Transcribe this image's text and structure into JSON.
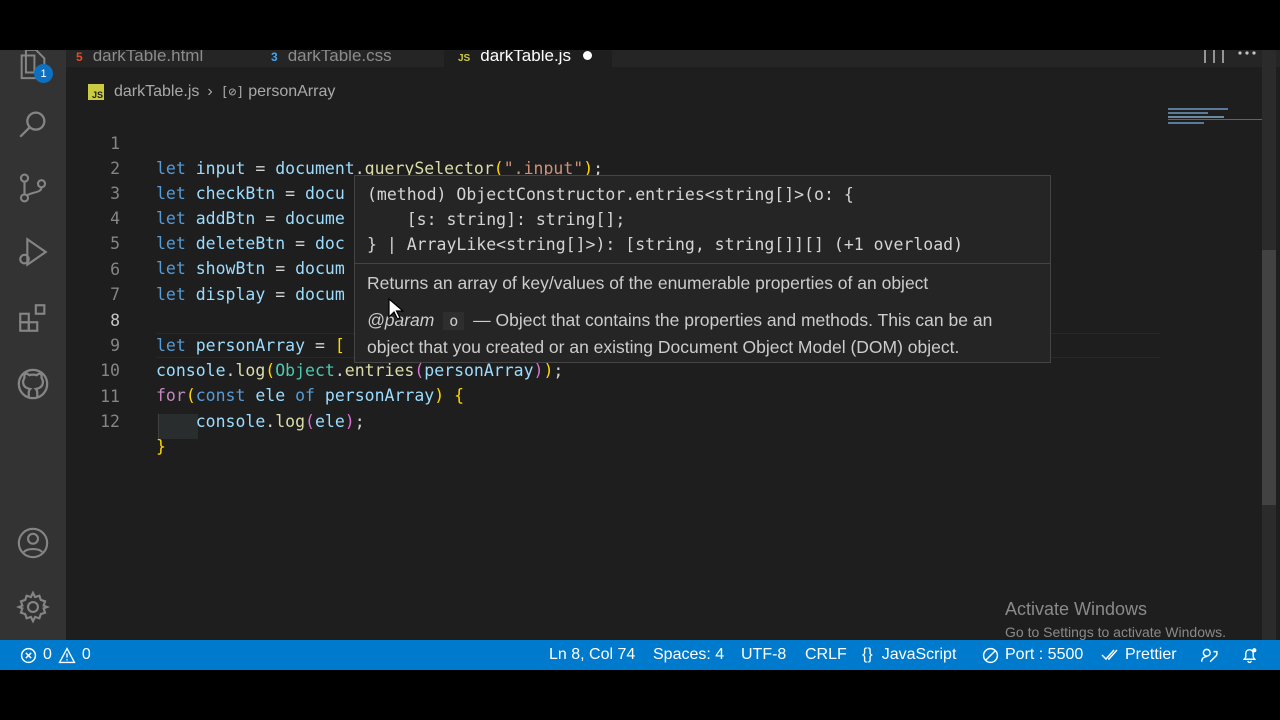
{
  "tabs": [
    {
      "icon": "html5-icon",
      "label": "darkTable.html",
      "active": false
    },
    {
      "icon": "css3-icon",
      "label": "darkTable.css",
      "active": false
    },
    {
      "icon": "js-file-icon",
      "label": "darkTable.js",
      "active": true,
      "modified": true
    }
  ],
  "activity_bar": {
    "explorer_badge": "1",
    "icons": [
      "files-icon",
      "search-icon",
      "source-control-icon",
      "run-debug-icon",
      "extensions-icon",
      "github-icon",
      "account-icon",
      "settings-gear-icon"
    ]
  },
  "breadcrumb": {
    "file_badge": "JS",
    "file": "darkTable.js",
    "symbol": "personArray"
  },
  "code_lines": [
    {
      "n": "1",
      "text": "let input = document.querySelector(\".input\");"
    },
    {
      "n": "2",
      "text": "let checkBtn = docu"
    },
    {
      "n": "3",
      "text": "let addBtn = docume"
    },
    {
      "n": "4",
      "text": "let deleteBtn = doc"
    },
    {
      "n": "5",
      "text": "let showBtn = docum"
    },
    {
      "n": "6",
      "text": "let display = docum"
    },
    {
      "n": "7",
      "text": ""
    },
    {
      "n": "8",
      "text": "let personArray = ["
    },
    {
      "n": "9",
      "text": "console.log(Object.entries(personArray));"
    },
    {
      "n": "10",
      "text": "for(const ele of personArray) {"
    },
    {
      "n": "11",
      "text": "    console.log(ele);"
    },
    {
      "n": "12",
      "text": "}"
    }
  ],
  "hover": {
    "sig_line1": "(method) ObjectConstructor.entries<string[]>(o: {",
    "sig_line2": "    [s: string]: string[];",
    "sig_line3": "} | ArrayLike<string[]>): [string, string[]][] (+1 overload)",
    "description": "Returns an array of key/values of the enumerable properties of an object",
    "param_tag": "@param",
    "param_name": "o",
    "param_desc_line1": "— Object that contains the properties and methods. This can be an",
    "param_desc_line2": "object that you created or an existing Document Object Model (DOM) object."
  },
  "watermark": {
    "title": "Activate Windows",
    "subtitle": "Go to Settings to activate Windows."
  },
  "status_bar": {
    "errors": "0",
    "warnings": "0",
    "position": "Ln 8, Col 74",
    "spaces": "Spaces: 4",
    "encoding": "UTF-8",
    "eol": "CRLF",
    "language": "JavaScript",
    "port": "Port : 5500",
    "prettier": "Prettier"
  },
  "colors": {
    "status_bar": "#007acc",
    "editor_bg": "#1e1e1e",
    "activity_bar": "#333333",
    "keyword": "#569cd6",
    "variable": "#9cdcfe",
    "function": "#dcdcaa",
    "string": "#ce9178",
    "class": "#4ec9b0"
  }
}
